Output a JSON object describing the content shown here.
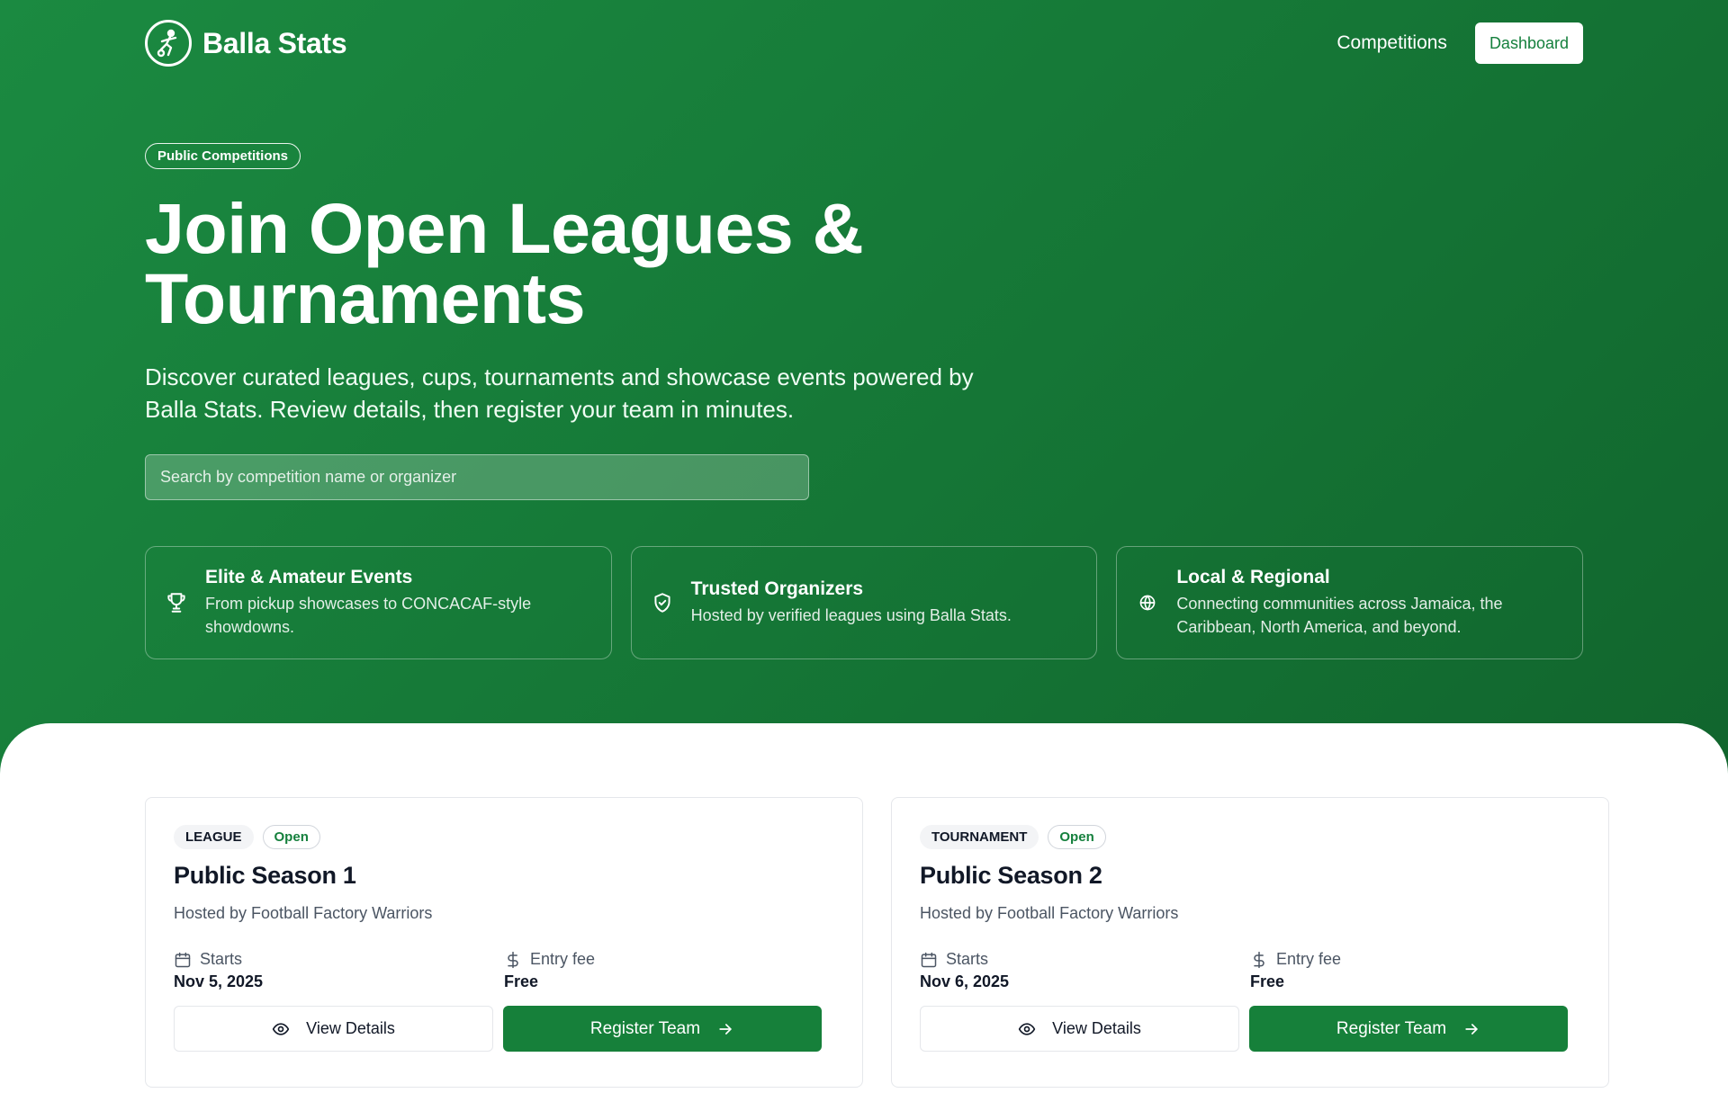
{
  "brand": {
    "name": "Balla Stats",
    "logo_icon": "soccer-player-icon"
  },
  "nav": {
    "competitions": "Competitions",
    "dashboard": "Dashboard"
  },
  "hero": {
    "pill": "Public Competitions",
    "title_line1": "Join Open Leagues &",
    "title_line2": "Tournaments",
    "subtitle_line1": "Discover curated leagues, cups, tournaments and showcase events powered by",
    "subtitle_line2": "Balla Stats. Review details, then register your team in minutes.",
    "search_placeholder": "Search by competition name or organizer"
  },
  "features": [
    {
      "icon": "trophy-icon",
      "title": "Elite & Amateur Events",
      "desc_line1": "From pickup showcases to CONCACAF-style",
      "desc_line2": "showdowns."
    },
    {
      "icon": "shield-check-icon",
      "title": "Trusted Organizers",
      "desc_line1": "Hosted by verified leagues using Balla Stats.",
      "desc_line2": ""
    },
    {
      "icon": "globe-icon",
      "title": "Local & Regional",
      "desc_line1": "Connecting communities across Jamaica, the",
      "desc_line2": "Caribbean, North America, and beyond."
    }
  ],
  "competitions": [
    {
      "type": "LEAGUE",
      "status": "Open",
      "title": "Public Season 1",
      "host": "Hosted by Football Factory Warriors",
      "starts_label": "Starts",
      "starts_value": "Nov 5, 2025",
      "fee_label": "Entry fee",
      "fee_value": "Free",
      "view_label": "View Details",
      "register_label": "Register Team"
    },
    {
      "type": "TOURNAMENT",
      "status": "Open",
      "title": "Public Season 2",
      "host": "Hosted by Football Factory Warriors",
      "starts_label": "Starts",
      "starts_value": "Nov 6, 2025",
      "fee_label": "Entry fee",
      "fee_value": "Free",
      "view_label": "View Details",
      "register_label": "Register Team"
    }
  ],
  "colors": {
    "primary_green": "#16803a",
    "hero_green": "#1b8a41",
    "status_green": "#15803d"
  }
}
